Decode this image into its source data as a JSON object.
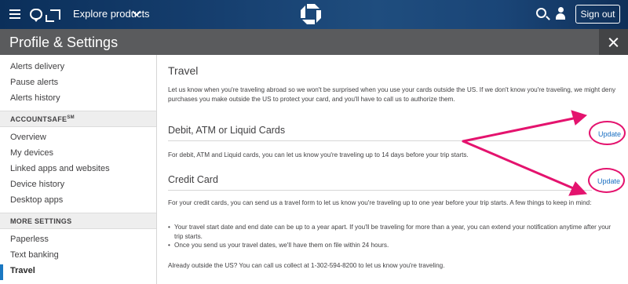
{
  "topnav": {
    "explore_label": "Explore products",
    "signout_label": "Sign out",
    "icons": [
      "menu-icon",
      "chat-icon",
      "card-icon",
      "chevron-down-icon",
      "chase-logo",
      "search-icon",
      "person-icon"
    ]
  },
  "header": {
    "title": "Profile & Settings",
    "close_icon": "close-icon"
  },
  "sidebar": {
    "items_top": [
      "Alerts delivery",
      "Pause alerts",
      "Alerts history"
    ],
    "section1": "ACCOUNTSAFE",
    "section1_sup": "SM",
    "items_mid": [
      "Overview",
      "My devices",
      "Linked apps and websites",
      "Device history",
      "Desktop apps"
    ],
    "section2": "MORE SETTINGS",
    "items_bottom": [
      "Paperless",
      "Text banking",
      "Travel"
    ],
    "active": "Travel"
  },
  "main": {
    "title": "Travel",
    "intro": "Let us know when you're traveling abroad so we won't be surprised when you use your cards outside the US. If we don't know you're traveling, we might deny purchases you make outside the US to protect your card, and you'll have to call us to authorize them.",
    "debit": {
      "heading": "Debit, ATM or Liquid Cards",
      "update_label": "Update",
      "text": "For debit, ATM and Liquid cards, you can let us know you're traveling up to 14 days before your trip starts."
    },
    "credit": {
      "heading": "Credit Card",
      "update_label": "Update",
      "text": "For your credit cards, you can send us a travel form to let us know you're traveling up to one year before your trip starts. A few things to keep in mind:",
      "bullets": [
        "Your travel start date and end date can be up to a year apart. If you'll be traveling for more than a year, you can extend your notification anytime after your trip starts.",
        "Once you send us your travel dates, we'll have them on file within 24 hours."
      ],
      "footer": "Already outside the US? You can call us collect at 1-302-594-8200 to let us know you're traveling."
    }
  },
  "annotation": {
    "color": "#e4136e"
  }
}
